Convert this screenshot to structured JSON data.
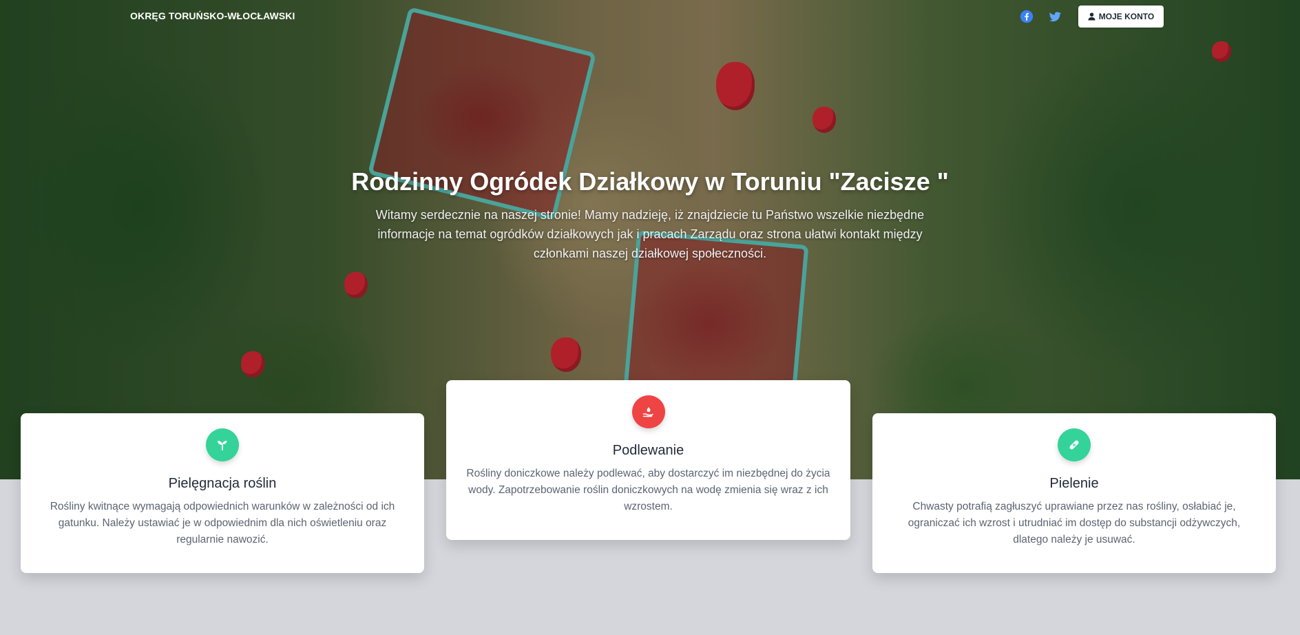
{
  "header": {
    "brand": "OKRĘG TORUŃSKO-WŁOCŁAWSKI",
    "social_icons": [
      "facebook-icon",
      "twitter-icon"
    ],
    "account_button": "MOJE KONTO"
  },
  "hero": {
    "title": "Rodzinny Ogródek Działkowy w Toruniu \"Zacisze \"",
    "subtitle": "Witamy serdecznie na naszej stronie! Mamy nadzieję, iż znajdziecie tu Państwo wszelkie niezbędne informacje na temat ogródków działkowych jak i pracach Zarządu oraz strona ułatwi kontakt między członkami naszej działkowej społeczności."
  },
  "cards": [
    {
      "title": "Pielęgnacja roślin",
      "text": "Rośliny kwitnące wymagają odpowiednich warunków w zależności od ich gatunku. Należy ustawiać je w odpowiednim dla nich oświetleniu oraz regularnie nawozić.",
      "icon": "seedling-icon",
      "icon_color": "#34d399"
    },
    {
      "title": "Podlewanie",
      "text": "Rośliny doniczkowe należy podlewać, aby dostarczyć im niezbędnej do życia wody. Zapotrzebowanie roślin doniczkowych na wodę zmienia się wraz z ich wzrostem.",
      "icon": "hand-holding-water-icon",
      "icon_color": "#ef4444"
    },
    {
      "title": "Pielenie",
      "text": "Chwasty potrafią zagłuszyć uprawiane przez nas rośliny, osłabiać je, ograniczać ich wzrost i utrudniać im dostęp do substancji odżywczych, dlatego należy je usuwać.",
      "icon": "bandage-icon",
      "icon_color": "#34d399"
    }
  ],
  "colors": {
    "page_bg": "#d4d6dc",
    "facebook": "#3b82f6",
    "twitter": "#60a5fa"
  }
}
